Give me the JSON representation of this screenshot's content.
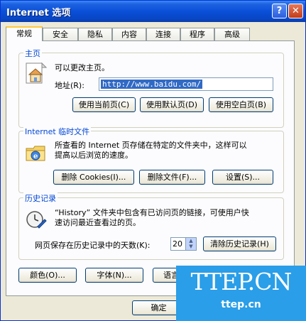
{
  "window": {
    "title": "Internet 选项",
    "help": "?",
    "close": "✕"
  },
  "tabs": [
    "常规",
    "安全",
    "隐私",
    "内容",
    "连接",
    "程序",
    "高级"
  ],
  "home": {
    "title": "主页",
    "desc": "可以更改主页。",
    "address_label": "地址(R):",
    "address_value": "http://www.baidu.com/",
    "btn_current": "使用当前页(C)",
    "btn_default": "使用默认页(D)",
    "btn_blank": "使用空白页(B)"
  },
  "temp": {
    "title": "Internet 临时文件",
    "desc1": "所查看的 Internet 页存储在特定的文件夹中，这样可以",
    "desc2": "提高以后浏览的速度。",
    "btn_cookies": "删除 Cookies(I)...",
    "btn_files": "删除文件(F)...",
    "btn_settings": "设置(S)..."
  },
  "history": {
    "title": "历史记录",
    "desc1": "“History” 文件夹中包含有已访问页的链接，可使用户快",
    "desc2": "速访问最近查看过的页。",
    "days_label": "网页保存在历史记录中的天数(K):",
    "days_value": "20",
    "btn_clear": "清除历史记录(H)"
  },
  "bottom": {
    "btn_colors": "颜色(O)...",
    "btn_fonts": "字体(N)...",
    "btn_lang": "语言"
  },
  "footer": {
    "ok": "确定"
  },
  "watermark": {
    "big": "TTEP.CN",
    "small": "ttep.cn"
  }
}
